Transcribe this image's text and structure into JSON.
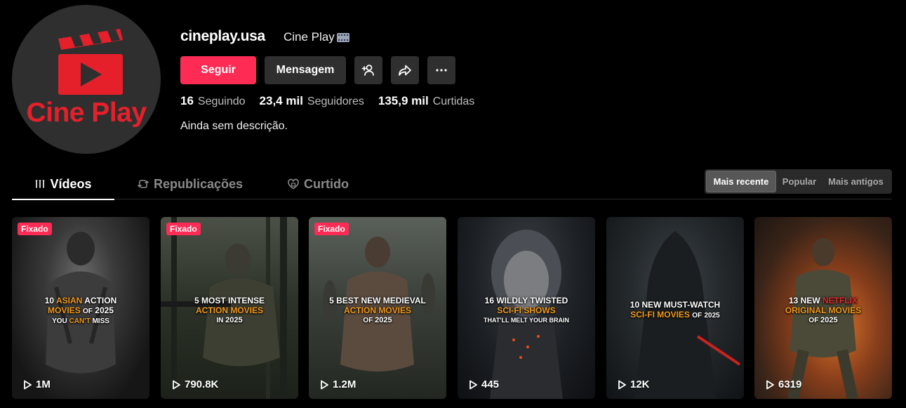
{
  "profile": {
    "handle": "cineplay.usa",
    "nickname": "Cine Play",
    "nickname_emoji": "film-frames-icon",
    "avatar_text": "Cine Play",
    "bio": "Ainda sem descrição.",
    "brand_color": "#e5202b"
  },
  "actions": {
    "follow_label": "Seguir",
    "message_label": "Mensagem",
    "add_friend_icon": "add-user-icon",
    "share_icon": "share-icon",
    "more_icon": "more-icon",
    "follow_color": "#fe2c55"
  },
  "stats": [
    {
      "value": "16",
      "label": "Seguindo"
    },
    {
      "value": "23,4 mil",
      "label": "Seguidores"
    },
    {
      "value": "135,9 mil",
      "label": "Curtidas"
    }
  ],
  "tabs": [
    {
      "label": "Vídeos",
      "icon": "grid-icon",
      "active": true
    },
    {
      "label": "Republicações",
      "icon": "repost-icon",
      "active": false
    },
    {
      "label": "Curtido",
      "icon": "heart-icon",
      "active": false
    }
  ],
  "sort": {
    "options": [
      "Mais recente",
      "Popular",
      "Mais antigos"
    ],
    "selected": "Mais recente"
  },
  "videos": [
    {
      "pinned": true,
      "pinned_label": "Fixado",
      "views": "1M",
      "title": [
        "10 ASIAN ACTION",
        "MOVIES OF 2025",
        "YOU CAN'T MISS"
      ]
    },
    {
      "pinned": true,
      "pinned_label": "Fixado",
      "views": "790.8K",
      "title": [
        "5 MOST INTENSE",
        "ACTION MOVIES",
        "IN 2025"
      ]
    },
    {
      "pinned": true,
      "pinned_label": "Fixado",
      "views": "1.2M",
      "title": [
        "5 BEST NEW MEDIEVAL",
        "ACTION MOVIES",
        "OF 2025"
      ]
    },
    {
      "pinned": false,
      "views": "445",
      "title": [
        "16 WILDLY TWISTED",
        "SCI-FI SHOWS",
        "THAT'LL MELT YOUR BRAIN"
      ]
    },
    {
      "pinned": false,
      "views": "12K",
      "title": [
        "10 NEW MUST-WATCH",
        "SCI-FI MOVIES OF 2025"
      ]
    },
    {
      "pinned": false,
      "views": "6319",
      "title": [
        "13 NEW NETFLIX",
        "ORIGINAL MOVIES",
        "OF 2025"
      ]
    }
  ]
}
